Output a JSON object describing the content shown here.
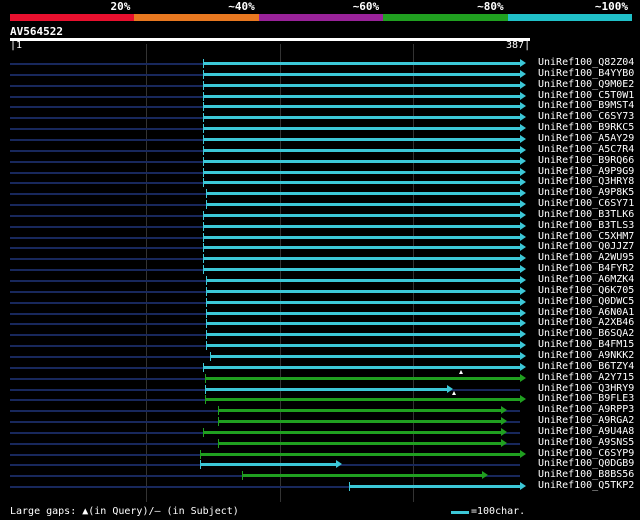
{
  "color_scale": {
    "segments": [
      {
        "color": "#e8102e",
        "label": "20%"
      },
      {
        "color": "#e87820",
        "label": "~40%"
      },
      {
        "color": "#992299",
        "label": "~60%"
      },
      {
        "color": "#20a020",
        "label": "~80%"
      },
      {
        "color": "#20c0c8",
        "label": "~100%"
      }
    ]
  },
  "query": {
    "name": "AV564522",
    "start": "1",
    "end": "387"
  },
  "rows": [
    {
      "name": "UniRef100_Q82Z04",
      "start": 0.378,
      "end": 1.0,
      "color": "#3cc8d8"
    },
    {
      "name": "UniRef100_B4YYB0",
      "start": 0.378,
      "end": 1.0,
      "color": "#3cc8d8"
    },
    {
      "name": "UniRef100_Q9M0E2",
      "start": 0.378,
      "end": 1.0,
      "color": "#3cc8d8"
    },
    {
      "name": "UniRef100_C5T0W1",
      "start": 0.378,
      "end": 1.0,
      "color": "#3cc8d8"
    },
    {
      "name": "UniRef100_B9MST4",
      "start": 0.378,
      "end": 1.0,
      "color": "#3cc8d8"
    },
    {
      "name": "UniRef100_C6SY73",
      "start": 0.378,
      "end": 1.0,
      "color": "#3cc8d8"
    },
    {
      "name": "UniRef100_B9RKC5",
      "start": 0.378,
      "end": 1.0,
      "color": "#3cc8d8"
    },
    {
      "name": "UniRef100_A5AY29",
      "start": 0.378,
      "end": 1.0,
      "color": "#3cc8d8"
    },
    {
      "name": "UniRef100_A5C7R4",
      "start": 0.378,
      "end": 1.0,
      "color": "#3cc8d8"
    },
    {
      "name": "UniRef100_B9RQ66",
      "start": 0.378,
      "end": 1.0,
      "color": "#3cc8d8"
    },
    {
      "name": "UniRef100_A9P9G9",
      "start": 0.378,
      "end": 1.0,
      "color": "#3cc8d8"
    },
    {
      "name": "UniRef100_Q3HRY8",
      "start": 0.378,
      "end": 1.0,
      "color": "#3cc8d8"
    },
    {
      "name": "UniRef100_A9P8K5",
      "start": 0.385,
      "end": 1.0,
      "color": "#3cc8d8"
    },
    {
      "name": "UniRef100_C6SY71",
      "start": 0.385,
      "end": 1.0,
      "color": "#3cc8d8"
    },
    {
      "name": "UniRef100_B3TLK6",
      "start": 0.378,
      "end": 1.0,
      "color": "#3cc8d8"
    },
    {
      "name": "UniRef100_B3TLS3",
      "start": 0.378,
      "end": 1.0,
      "color": "#3cc8d8"
    },
    {
      "name": "UniRef100_C5XHM7",
      "start": 0.378,
      "end": 1.0,
      "color": "#3cc8d8"
    },
    {
      "name": "UniRef100_Q0JJZ7",
      "start": 0.378,
      "end": 1.0,
      "color": "#3cc8d8"
    },
    {
      "name": "UniRef100_A2WU95",
      "start": 0.378,
      "end": 1.0,
      "color": "#3cc8d8"
    },
    {
      "name": "UniRef100_B4FYR2",
      "start": 0.378,
      "end": 1.0,
      "color": "#3cc8d8"
    },
    {
      "name": "UniRef100_A6MZK4",
      "start": 0.385,
      "end": 1.0,
      "color": "#3cc8d8"
    },
    {
      "name": "UniRef100_Q6K705",
      "start": 0.385,
      "end": 1.0,
      "color": "#3cc8d8"
    },
    {
      "name": "UniRef100_Q0DWC5",
      "start": 0.385,
      "end": 1.0,
      "color": "#3cc8d8"
    },
    {
      "name": "UniRef100_A6N0A1",
      "start": 0.385,
      "end": 1.0,
      "color": "#3cc8d8"
    },
    {
      "name": "UniRef100_A2XB46",
      "start": 0.385,
      "end": 1.0,
      "color": "#3cc8d8"
    },
    {
      "name": "UniRef100_B6SQA2",
      "start": 0.385,
      "end": 1.0,
      "color": "#3cc8d8"
    },
    {
      "name": "UniRef100_B4FM15",
      "start": 0.385,
      "end": 1.0,
      "color": "#3cc8d8"
    },
    {
      "name": "UniRef100_A9NKK2",
      "start": 0.392,
      "end": 1.0,
      "color": "#3cc8d8"
    },
    {
      "name": "UniRef100_B6TZY4",
      "start": 0.378,
      "end": 1.0,
      "color": "#3cc8d8"
    },
    {
      "name": "UniRef100_A2Y715",
      "start": 0.382,
      "end": 1.0,
      "color": "#20a020",
      "gap": 0.885
    },
    {
      "name": "UniRef100_Q3HRY9",
      "start": 0.382,
      "end": 0.857,
      "color": "#3cc8d8"
    },
    {
      "name": "UniRef100_B9FLE3",
      "start": 0.382,
      "end": 1.0,
      "color": "#20a020",
      "gap": 0.87
    },
    {
      "name": "UniRef100_A9RPP3",
      "start": 0.408,
      "end": 0.962,
      "color": "#20a020"
    },
    {
      "name": "UniRef100_A9RGA2",
      "start": 0.408,
      "end": 0.962,
      "color": "#20a020"
    },
    {
      "name": "UniRef100_A9U4A8",
      "start": 0.378,
      "end": 0.962,
      "color": "#20a020"
    },
    {
      "name": "UniRef100_A9SNS5",
      "start": 0.408,
      "end": 0.962,
      "color": "#20a020"
    },
    {
      "name": "UniRef100_C6SYP9",
      "start": 0.373,
      "end": 1.0,
      "color": "#20a020"
    },
    {
      "name": "UniRef100_Q0DGB9",
      "start": 0.373,
      "end": 0.64,
      "color": "#3cc8d8"
    },
    {
      "name": "UniRef100_B8BS56",
      "start": 0.455,
      "end": 0.925,
      "color": "#20a020"
    },
    {
      "name": "UniRef100_Q5TKP2",
      "start": 0.665,
      "end": 1.0,
      "color": "#3cc8d8"
    }
  ],
  "footer": {
    "legend_text": "Large gaps: ▲(in Query)/— (in Subject)",
    "scale_text": "=100char."
  }
}
